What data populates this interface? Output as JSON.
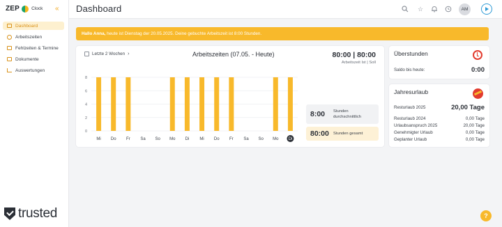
{
  "brand": {
    "name": "ZEP",
    "product": "Clock"
  },
  "header": {
    "title": "Dashboard",
    "avatar": "AM"
  },
  "sidebar": {
    "items": [
      {
        "label": "Dashboard",
        "icon": "home-icon"
      },
      {
        "label": "Arbeitszeiten",
        "icon": "clock-icon"
      },
      {
        "label": "Fehlzeiten & Termine",
        "icon": "calendar-icon"
      },
      {
        "label": "Dokumente",
        "icon": "folder-icon"
      },
      {
        "label": "Auswertungen",
        "icon": "chart-icon"
      }
    ],
    "badge": "trusted"
  },
  "banner": {
    "greeting": "Hallo Anna,",
    "text": " heute ist Dienstag der 20.05.2025. Deine gebuchte Arbeitszeit ist 8:00 Stunden."
  },
  "worktime": {
    "period": "Letzte 2 Wochen",
    "title": "Arbeitszeiten (07.05. - Heute)",
    "total": "80:00 | 80:00",
    "total_label": "Arbeitszeit Ist | Soll",
    "avg_value": "8:00",
    "avg_label": "Stunden durchschnittlich",
    "sum_value": "80:00",
    "sum_label": "Stunden gesamt"
  },
  "chart_data": {
    "type": "bar",
    "categories": [
      "Mi",
      "Do",
      "Fr",
      "Sa",
      "So",
      "Mo",
      "Di",
      "Mi",
      "Do",
      "Fr",
      "Sa",
      "So",
      "Mo",
      "Di"
    ],
    "values": [
      8,
      8,
      8,
      0,
      0,
      8,
      8,
      8,
      8,
      8,
      0,
      0,
      8,
      8
    ],
    "yticks": [
      0,
      2,
      4,
      6,
      8
    ],
    "ylim": [
      0,
      8
    ],
    "grid": true,
    "highlight_index": 13,
    "bar_color": "#f8b92b",
    "title": "Arbeitszeiten (07.05. - Heute)"
  },
  "overtime": {
    "title": "Überstunden",
    "label": "Saldo bis heute:",
    "value": "0:00"
  },
  "vacation": {
    "title": "Jahresurlaub",
    "rest_label": "Resturlaub 2025",
    "rest_value": "20,00 Tage",
    "rows": [
      {
        "label": "Resturlaub 2024",
        "value": "0,00 Tage"
      },
      {
        "label": "Urlaubsanspruch 2025",
        "value": "20,00 Tage"
      },
      {
        "label": "Genehmigter Urlaub",
        "value": "0,00 Tage"
      },
      {
        "label": "Geplanter Urlaub",
        "value": "0,00 Tage"
      }
    ]
  },
  "help": "?",
  "colors": {
    "accent": "#f8b92b",
    "active_bg": "#fdf0cf",
    "play": "#2f9bd6"
  }
}
